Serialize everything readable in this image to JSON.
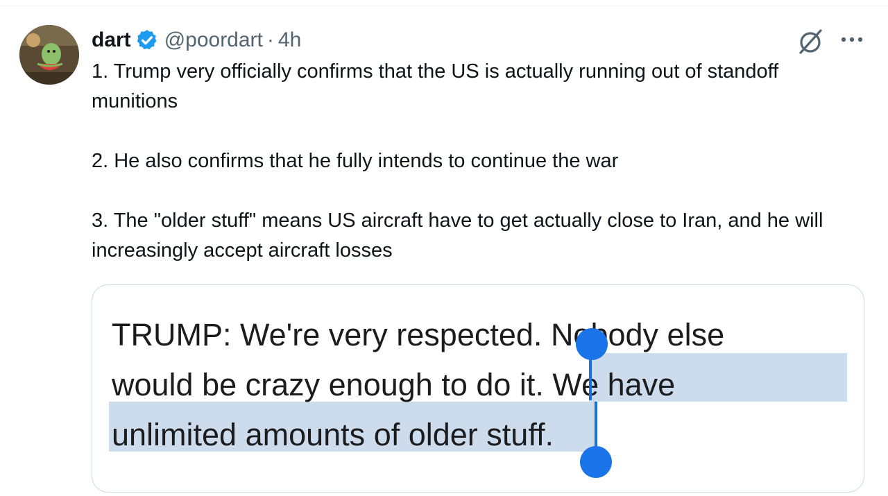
{
  "post": {
    "author": {
      "display_name": "dart",
      "handle": "@poordart",
      "separator": "·",
      "time": "4h",
      "verified": true,
      "avatar_icon": "avatar-image"
    },
    "actions": {
      "grok_icon": "grok-icon",
      "more_icon": "more-icon"
    },
    "text": {
      "p1": "1. Trump very officially confirms that the US is actually running out of standoff munitions",
      "p2": "2. He also confirms that he fully intends to continue the war",
      "p3": "3. The \"older stuff\" means US aircraft have to get actually close to Iran, and he will increasingly accept aircraft losses"
    },
    "media": {
      "line1_a": "TRUMP: We're very respected. ",
      "line1_b": "Nobody else",
      "line2_a": "would be crazy enough to do it. ",
      "line2_b": "We have",
      "line3_a": "unlimited amounts of older stuff.",
      "selection_color": "#cddcec",
      "handle_color": "#1a73e8"
    },
    "colors": {
      "verified_badge": "#1d9bf0",
      "secondary_text": "#536471",
      "primary_text": "#0f1419"
    }
  }
}
